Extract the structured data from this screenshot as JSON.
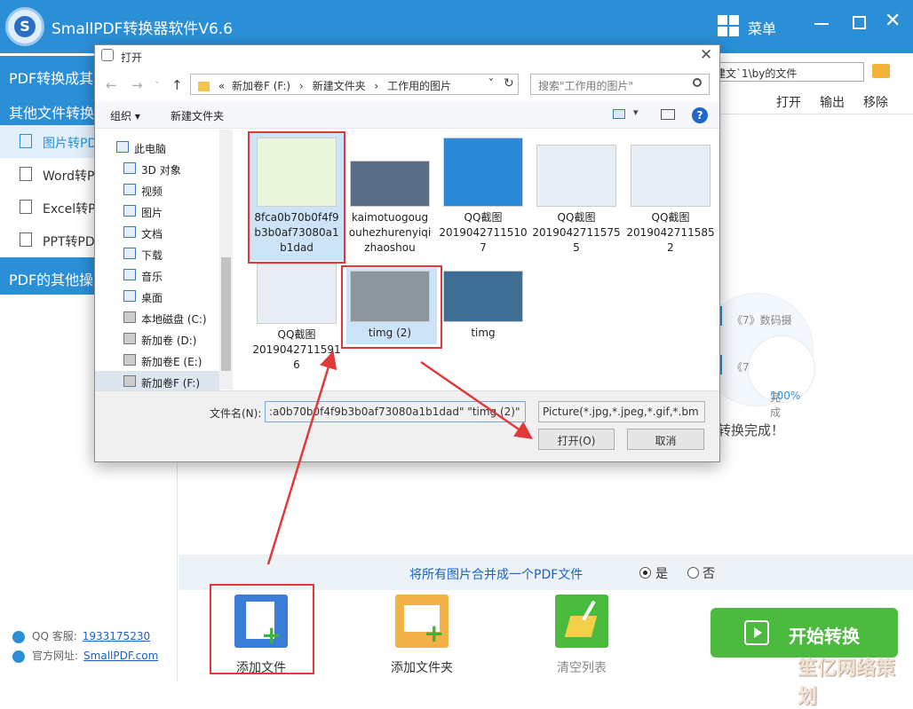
{
  "app": {
    "title": "SmallPDF转换器软件V6.6",
    "logo_letter": "S",
    "menu_label": "菜单",
    "close_glyph": "✕"
  },
  "sidebar": {
    "section1": "PDF转换成其",
    "section2": "其他文件转换",
    "items": [
      {
        "label": "图片转PD",
        "active": true
      },
      {
        "label": "Word转P"
      },
      {
        "label": "Excel转P"
      },
      {
        "label": "PPT转PD"
      }
    ],
    "section3": "PDF的其他操",
    "qq_label": "QQ 客服:",
    "qq_value": "1933175230",
    "site_label": "官方网址:",
    "site_value": "SmallPDF.com"
  },
  "main": {
    "path_value": "建文`1\\by的文件",
    "actions": [
      "打开",
      "输出",
      "移除"
    ],
    "file_items": [
      "《7》数码摄",
      "《7》"
    ],
    "progress_text": "100%",
    "progress_state": "完成",
    "status_text": "转换完成！",
    "merge_label": "将所有图片合并成一个PDF文件",
    "radio_yes": "是",
    "radio_no": "否",
    "tools": {
      "add_file": "添加文件",
      "add_folder": "添加文件夹",
      "clear_list": "清空列表"
    },
    "start_button": "开始转换",
    "watermark": "笙亿网络策划"
  },
  "dialog": {
    "title": "打开",
    "close_glyph": "✕",
    "nav": {
      "back": "←",
      "forward": "→",
      "dropdown": "˅",
      "up": "↑",
      "refresh": "↻"
    },
    "address": [
      "«",
      "新加卷F (F:)",
      "›",
      "新建文件夹",
      "›",
      "工作用的图片"
    ],
    "address_dropdown": "˅",
    "search_placeholder": "搜索\"工作用的图片\"",
    "organize": "组织 ▾",
    "new_folder": "新建文件夹",
    "help": "?",
    "tree": [
      {
        "label": "此电脑"
      },
      {
        "label": "3D 对象"
      },
      {
        "label": "视频"
      },
      {
        "label": "图片"
      },
      {
        "label": "文档"
      },
      {
        "label": "下载"
      },
      {
        "label": "音乐"
      },
      {
        "label": "桌面"
      },
      {
        "label": "本地磁盘 (C:)"
      },
      {
        "label": "新加卷 (D:)"
      },
      {
        "label": "新加卷E (E:)"
      },
      {
        "label": "新加卷F (F:)",
        "selected": true
      }
    ],
    "files": [
      {
        "name": "8fca0b70b0f4f9b3b0af73080a1b1dad",
        "lines": [
          "8fca0b70b0f4f9",
          "b3b0af73080a1",
          "b1dad"
        ],
        "selected": true,
        "color": "#eaf6dc"
      },
      {
        "name": "kaimotuogou",
        "lines": [
          "kaimotuogoug",
          "ouhezhurenyiqi",
          "zhaoshou"
        ],
        "color": "#5b6c86"
      },
      {
        "name": "QQ截图201904271151 07",
        "lines": [
          "QQ截图",
          "2019042711510",
          "7"
        ],
        "color": "#2b88d8"
      },
      {
        "name": "QQ截图201904271157 55",
        "lines": [
          "QQ截图",
          "2019042711575",
          "5"
        ],
        "color": "#e9eef6"
      },
      {
        "name": "QQ截图201904271158 52",
        "lines": [
          "QQ截图",
          "2019042711585",
          "2"
        ],
        "color": "#e9eef6"
      },
      {
        "name": "QQ截图201904271159 16",
        "lines": [
          "QQ截图",
          "2019042711591",
          "6"
        ],
        "color": "#e9eef6"
      },
      {
        "name": "timg (2)",
        "lines": [
          "timg (2)"
        ],
        "selected": true,
        "color": "#8d959f"
      },
      {
        "name": "timg",
        "lines": [
          "timg"
        ],
        "color": "#3e6e93"
      }
    ],
    "filename_label": "文件名(N):",
    "filename_value": ":a0b70b0f4f9b3b0af73080a1b1dad\" \"timg (2)\"",
    "filetype_value": "Picture(*.jpg,*.jpeg,*.gif,*.bm",
    "open_button": "打开(O)",
    "cancel_button": "取消"
  }
}
